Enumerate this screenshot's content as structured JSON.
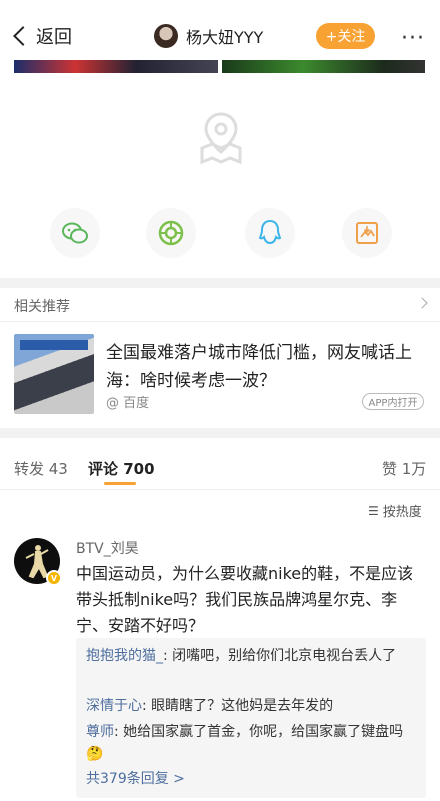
{
  "header": {
    "back_label": "返回",
    "username": "杨大妞YYY",
    "follow_label": "+关注",
    "more_label": "···"
  },
  "share": {
    "icons": [
      "wechat-icon",
      "moments-icon",
      "qq-icon",
      "save-image-icon"
    ]
  },
  "recommend": {
    "title": "相关推荐",
    "headline": "全国最难落户城市降低门槛，网友喊话上海：啥时候考虑一波？",
    "source": "@ 百度",
    "badge": "APP内打开"
  },
  "tabs": {
    "repost": "转发 43",
    "comment": "评论 700",
    "like": "赞 1万"
  },
  "sort_label": "按热度",
  "comment": {
    "author": "BTV_刘昊",
    "text": "中国运动员，为什么要收藏nike的鞋，不是应该带头抵制nike吗？我们民族品牌鸿星尔克、李宁、安踏不好吗？",
    "replies": [
      {
        "user": "抱抱我的猫_",
        "text": ": 闭嘴吧，别给你们北京电视台丢人了"
      },
      {
        "user": "深情于心",
        "text": ": 眼睛瞎了？这他妈是去年发的"
      },
      {
        "user": "尊师",
        "text": ": 她给国家赢了首金，你呢，给国家赢了键盘吗"
      }
    ],
    "reply_total": "共379条回复 >"
  },
  "colors": {
    "accent": "#f7a233",
    "link": "#4e6e9e"
  }
}
